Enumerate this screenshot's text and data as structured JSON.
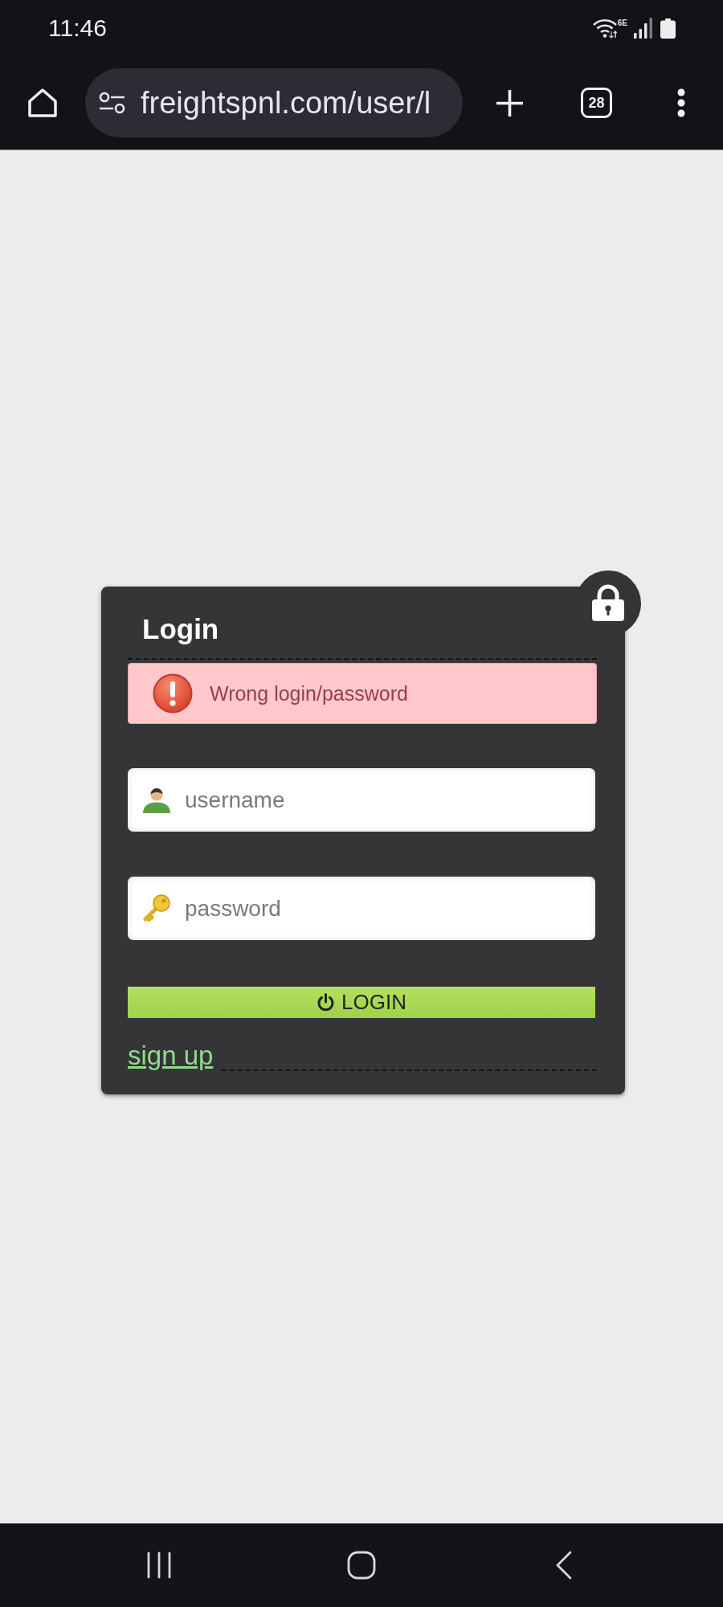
{
  "status_bar": {
    "time": "11:46",
    "wifi_label": "6E"
  },
  "browser": {
    "url": "freightspnl.com/user/l",
    "tab_count": "28"
  },
  "login_card": {
    "title": "Login",
    "alert": {
      "kind": "error",
      "message": "Wrong login/password"
    },
    "fields": [
      {
        "kind": "username",
        "placeholder": "username"
      },
      {
        "kind": "password",
        "placeholder": "password"
      }
    ],
    "submit_button": "LOGIN",
    "signup_link": "sign up"
  }
}
